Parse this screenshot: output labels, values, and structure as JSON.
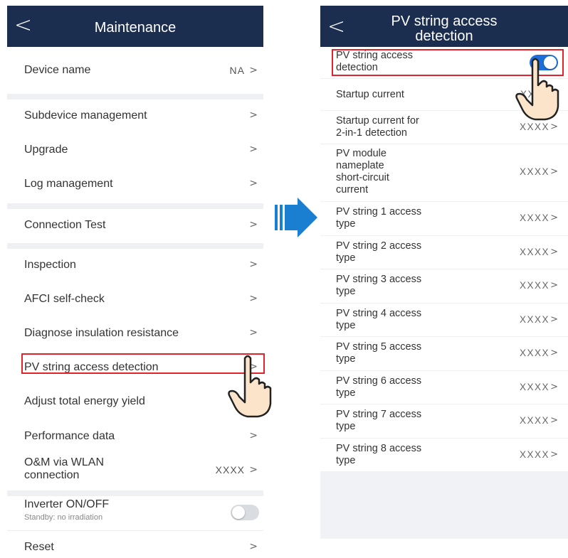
{
  "left": {
    "title": "Maintenance",
    "device_name": {
      "label": "Device name",
      "value": "NA"
    },
    "items": [
      "Subdevice management",
      "Upgrade",
      "Log management",
      "Connection Test",
      "Inspection",
      "AFCI self-check",
      "Diagnose insulation resistance",
      "PV string access detection",
      "Adjust total energy yield",
      "Performance data"
    ],
    "om_wlan": {
      "label_line1": "O&M via WLAN",
      "label_line2": "connection",
      "value": "XXXX"
    },
    "inverter": {
      "label": "Inverter ON/OFF",
      "status": "Standby: no irradiation",
      "on": false
    },
    "reset": "Reset",
    "chevron": ">",
    "back": "<"
  },
  "right": {
    "title_line1": "PV string access",
    "title_line2": "detection",
    "detection": {
      "label_line1": "PV string access",
      "label_line2": "detection",
      "on": true
    },
    "startup_current": {
      "label": "Startup current",
      "value": "XX"
    },
    "startup_2in1": {
      "label_line1": "Startup current for",
      "label_line2": "2-in-1 detection",
      "value": "XXXX"
    },
    "nameplate": {
      "line1": "PV module",
      "line2": "nameplate",
      "line3": "short-circuit",
      "line4": "current",
      "value": "XXXX"
    },
    "strings": [
      {
        "line1": "PV string 1 access",
        "line2": "type",
        "value": "XXXX"
      },
      {
        "line1": "PV string 2 access",
        "line2": "type",
        "value": "XXXX"
      },
      {
        "line1": "PV string 3 access",
        "line2": "type",
        "value": "XXXX"
      },
      {
        "line1": "PV string 4 access",
        "line2": "type",
        "value": "XXXX"
      },
      {
        "line1": "PV string 5 access",
        "line2": "type",
        "value": "XXXX"
      },
      {
        "line1": "PV string 6 access",
        "line2": "type",
        "value": "XXXX"
      },
      {
        "line1": "PV string 7 access",
        "line2": "type",
        "value": "XXXX"
      },
      {
        "line1": "PV string 8 access",
        "line2": "type",
        "value": "XXXX"
      }
    ]
  },
  "colors": {
    "header": "#1b2e4f",
    "highlight": "#e0242b",
    "toggle_on": "#1d6fd8",
    "arrow": "#1a7fd0"
  }
}
